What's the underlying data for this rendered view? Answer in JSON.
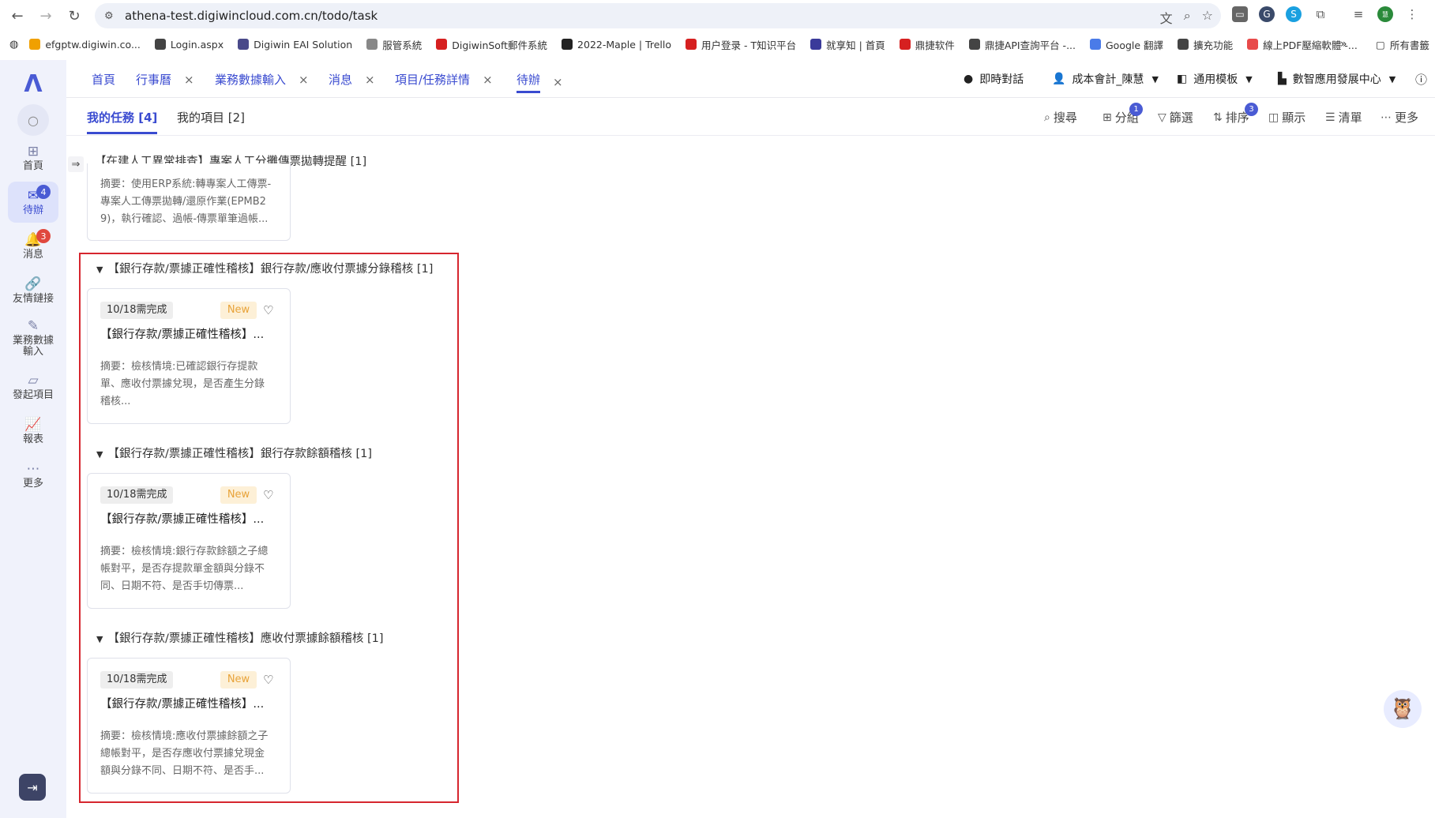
{
  "browser": {
    "url": "athena-test.digiwincloud.com.cn/todo/task",
    "bookmarks": [
      {
        "label": "efgptw.digiwin.co...",
        "color": "#f0a000"
      },
      {
        "label": "Login.aspx",
        "color": "#444444"
      },
      {
        "label": "Digiwin EAI Solution",
        "color": "#4a4a8a"
      },
      {
        "label": "服管系統",
        "color": "#888888"
      },
      {
        "label": "DigiwinSoft郵件系統",
        "color": "#d62020"
      },
      {
        "label": "2022-Maple | Trello",
        "color": "#222222"
      },
      {
        "label": "用户登录 - T知识平台",
        "color": "#d62020"
      },
      {
        "label": "就享知 | 首頁",
        "color": "#3a3a9a"
      },
      {
        "label": "鼎捷软件",
        "color": "#d62020"
      },
      {
        "label": "鼎捷API查詢平台 -...",
        "color": "#444444"
      },
      {
        "label": "Google 翻譯",
        "color": "#4a7be8"
      },
      {
        "label": "擴充功能",
        "color": "#444444"
      },
      {
        "label": "線上PDF壓縮軟體 -...",
        "color": "#e84a4a"
      }
    ],
    "bookmarks_overflow": "»",
    "all_bookmarks": "所有書籤"
  },
  "rail": {
    "items": [
      {
        "label": "首頁",
        "icon": "grid-icon"
      },
      {
        "label": "待辦",
        "icon": "todo-icon",
        "badge": "4"
      },
      {
        "label": "消息",
        "icon": "bell-icon",
        "badge": "3"
      },
      {
        "label": "友情鏈接",
        "icon": "link-icon"
      },
      {
        "label": "業務數據\n輸入",
        "icon": "edit-icon"
      },
      {
        "label": "發起項目",
        "icon": "folder-icon"
      },
      {
        "label": "報表",
        "icon": "chart-icon"
      },
      {
        "label": "更多",
        "icon": "more-icon"
      }
    ]
  },
  "tabs": {
    "items": [
      {
        "label": "首頁",
        "closable": false
      },
      {
        "label": "行事曆",
        "closable": true
      },
      {
        "label": "業務數據輸入",
        "closable": true
      },
      {
        "label": "消息",
        "closable": true
      },
      {
        "label": "項目/任務詳情",
        "closable": true
      },
      {
        "label": "待辦",
        "closable": true
      }
    ],
    "right": {
      "chat": "即時對話",
      "user": "成本會計_陳慧",
      "template": "通用模板",
      "org": "數智應用發展中心"
    }
  },
  "subtabs": {
    "my_tasks": "我的任務 [4]",
    "my_projects": "我的項目 [2]"
  },
  "toolbar": {
    "search": "搜尋",
    "group": "分組",
    "group_badge": "1",
    "filter": "篩選",
    "sort": "排序",
    "sort_badge": "3",
    "display": "顯示",
    "list": "清單",
    "more": "更多"
  },
  "groups": [
    {
      "title": "【在建人工異常排查】專案人工分攤傳票拋轉提醒 [1]",
      "summary": [
        "摘要：使用ERP系統:轉專案人工傳票-",
        "專案人工傳票拋轉/還原作業(EPMB2",
        "9)，執行確認、過帳-傳票單筆過帳..."
      ]
    },
    {
      "title": "【銀行存款/票據正確性稽核】銀行存款/應收付票據分錄稽核 [1]",
      "card": {
        "due": "10/18需完成",
        "badge": "New",
        "title": "【銀行存款/票據正確性稽核】...",
        "summary": [
          "摘要：檢核情境:已確認銀行存提款",
          "單、應收付票據兌現，是否產生分錄",
          "稽核..."
        ]
      }
    },
    {
      "title": "【銀行存款/票據正確性稽核】銀行存款餘額稽核 [1]",
      "card": {
        "due": "10/18需完成",
        "badge": "New",
        "title": "【銀行存款/票據正確性稽核】...",
        "summary": [
          "摘要：檢核情境:銀行存款餘額之子總",
          "帳對平，是否存提款單金額與分錄不",
          "同、日期不符、是否手切傳票..."
        ]
      }
    },
    {
      "title": "【銀行存款/票據正確性稽核】應收付票據餘額稽核 [1]",
      "card": {
        "due": "10/18需完成",
        "badge": "New",
        "title": "【銀行存款/票據正確性稽核】...",
        "summary": [
          "摘要：檢核情境:應收付票據餘額之子",
          "總帳對平，是否存應收付票據兌現金",
          "額與分錄不同、日期不符、是否手..."
        ]
      }
    }
  ]
}
